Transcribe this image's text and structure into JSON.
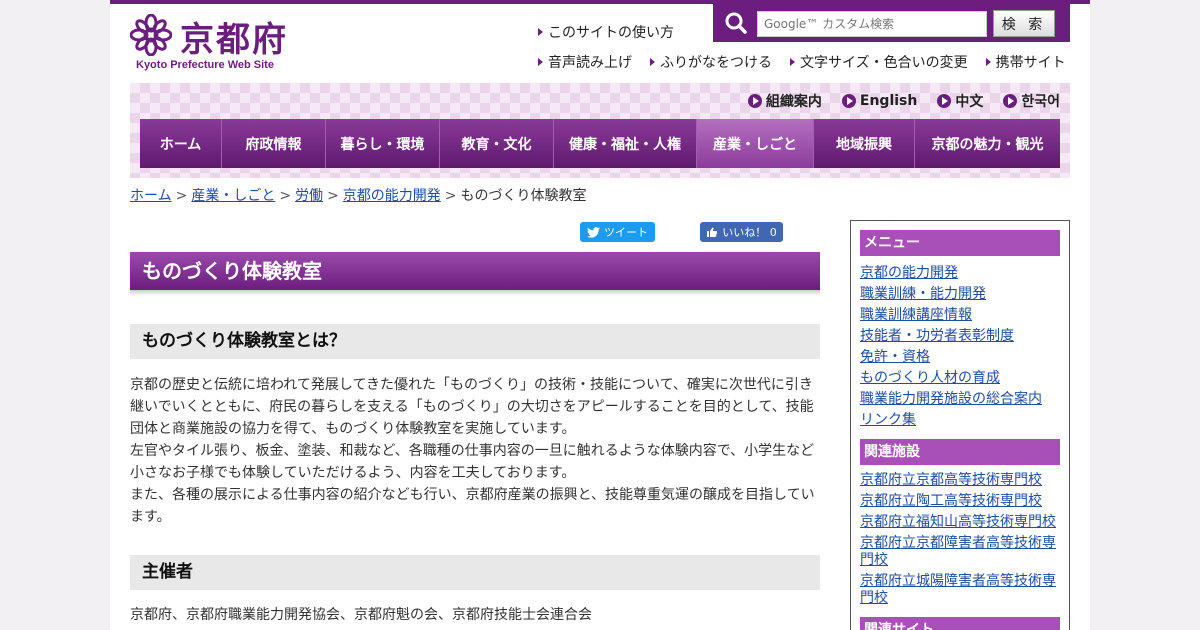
{
  "header": {
    "logo_text": "京都府",
    "logo_subtitle": "Kyoto Prefecture Web Site",
    "utility_top": "このサイトの使い方",
    "utility_links": [
      "音声読み上げ",
      "ふりがなをつける",
      "文字サイズ・色合いの変更",
      "携帯サイト"
    ],
    "search": {
      "placeholder": "Google™ カスタム検索",
      "button": "検 索"
    }
  },
  "lang_links": [
    "組織案内",
    "English",
    "中文",
    "한국어"
  ],
  "global_nav": [
    {
      "label": "ホーム",
      "active": false
    },
    {
      "label": "府政情報",
      "active": false
    },
    {
      "label": "暮らし・環境",
      "active": false
    },
    {
      "label": "教育・文化",
      "active": false
    },
    {
      "label": "健康・福祉・人権",
      "active": false
    },
    {
      "label": "産業・しごと",
      "active": true
    },
    {
      "label": "地域振興",
      "active": false
    },
    {
      "label": "京都の魅力・観光",
      "active": false
    }
  ],
  "breadcrumb": {
    "links": [
      "ホーム",
      "産業・しごと",
      "労働",
      "京都の能力開発"
    ],
    "current": "ものづくり体験教室"
  },
  "social": {
    "tweet": "ツイート",
    "like": "いいね！ 0"
  },
  "main": {
    "title": "ものづくり体験教室",
    "section1_heading": "ものづくり体験教室とは？",
    "paragraphs": [
      "京都の歴史と伝統に培われて発展してきた優れた「ものづくり」の技術・技能について、確実に次世代に引き継いでいくとともに、府民の暮らしを支える「ものづくり」の大切さをアピールすることを目的として、技能団体と商業施設の協力を得て、ものづくり体験教室を実施しています。",
      "左官やタイル張り、板金、塗装、和裁など、各職種の仕事内容の一旦に触れるような体験内容で、小学生など小さなお子様でも体験していただけるよう、内容を工夫しております。",
      "また、各種の展示による仕事内容の紹介なども行い、京都府産業の振興と、技能尊重気運の醸成を目指しています。"
    ],
    "section2_heading": "主催者",
    "organizers": "京都府、京都府職業能力開発協会、京都府魁の会、京都府技能士会連合会"
  },
  "sidebar": {
    "menu_heading": "メニュー",
    "menu_items": [
      "京都の能力開発",
      "職業訓練・能力開発",
      "職業訓練講座情報",
      "技能者・功労者表彰制度",
      "免許・資格",
      "ものづくり人材の育成",
      "職業能力開発施設の総合案内",
      "リンク集"
    ],
    "facilities_heading": "関連施設",
    "facilities_items": [
      "京都府立京都高等技術専門校",
      "京都府立陶工高等技術専門校",
      "京都府立福知山高等技術専門校",
      "京都府立京都障害者高等技術専門校",
      "京都府立城陽障害者高等技術専門校"
    ],
    "sites_heading": "関連サイト"
  },
  "colors": {
    "brand": "#6b1e7e",
    "sidebar_head": "#a84fb8",
    "link": "#1f4ea3"
  }
}
